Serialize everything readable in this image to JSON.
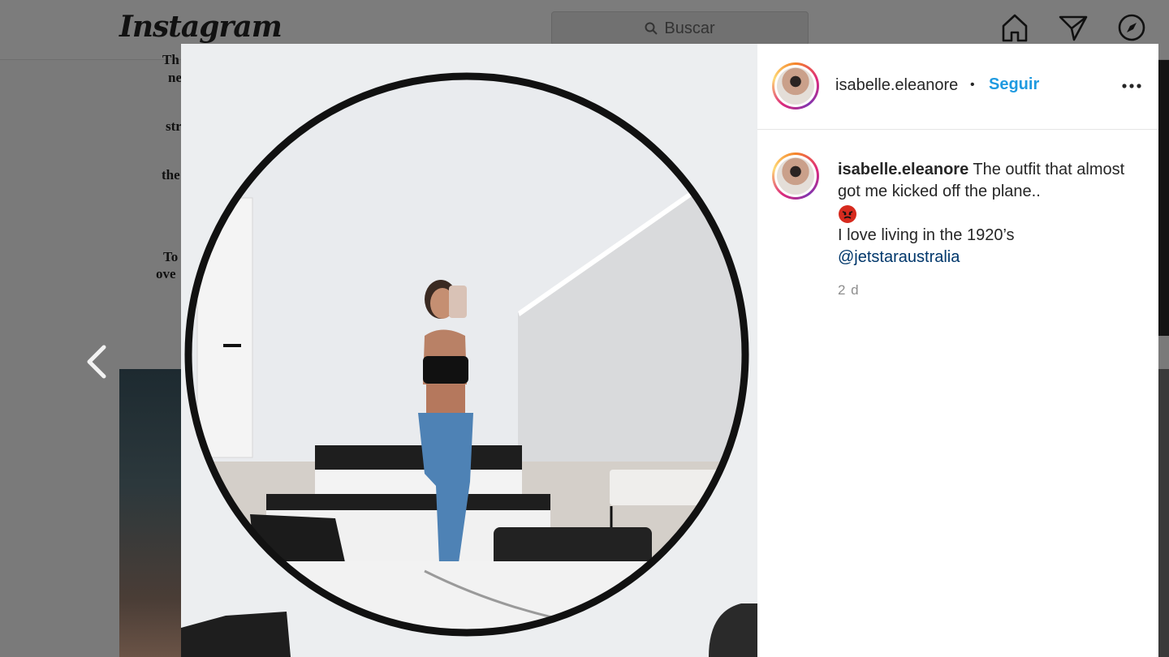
{
  "app": {
    "brand": "Instagram"
  },
  "search": {
    "placeholder": "Buscar"
  },
  "background_text": [
    "Th",
    "ne",
    "str",
    "the",
    "To",
    "ove"
  ],
  "post": {
    "username": "isabelle.eleanore",
    "separator": "•",
    "follow_label": "Seguir",
    "caption": {
      "username": "isabelle.eleanore",
      "line1": "The outfit that almost got me kicked off the plane..",
      "emoji": "pouting-face-emoji",
      "line2": "I love living in the 1920’s",
      "mention": "@jetstaraustralia"
    },
    "time": "2 d"
  },
  "icons": [
    "search-icon",
    "home-icon",
    "direct-message-icon",
    "explore-icon",
    "heart-icon",
    "chevron-left-icon",
    "more-options-icon"
  ],
  "colors": {
    "follow": "#1f9ae0",
    "mention": "#00376b",
    "overlay": "#7a7a7a"
  }
}
